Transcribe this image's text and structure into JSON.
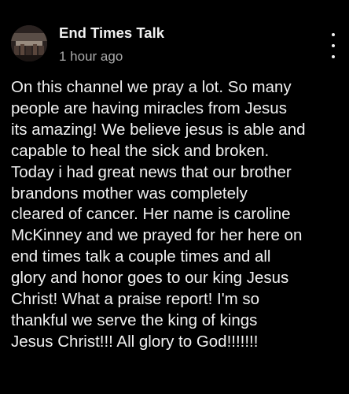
{
  "post": {
    "author": "End Times Talk",
    "timestamp": "1 hour ago",
    "more_icon": "more-vert-icon",
    "body": "On this channel we pray a lot. So many\npeople are having miracles from Jesus\nits amazing! We believe jesus is able and\ncapable to heal the sick and broken.\nToday i had great news that our brother\nbrandons mother was completely\ncleared of cancer. Her name is caroline\nMcKinney and we prayed for her here on\nend times talk a couple times and all\nglory and honor goes to our king Jesus\nChrist! What a praise report! I'm so\nthankful we serve the king of kings\nJesus Christ!!! All glory to God!!!!!!!"
  },
  "colors": {
    "background": "#000000",
    "text_primary": "#f1f1f1",
    "text_secondary": "#aaaaaa"
  }
}
